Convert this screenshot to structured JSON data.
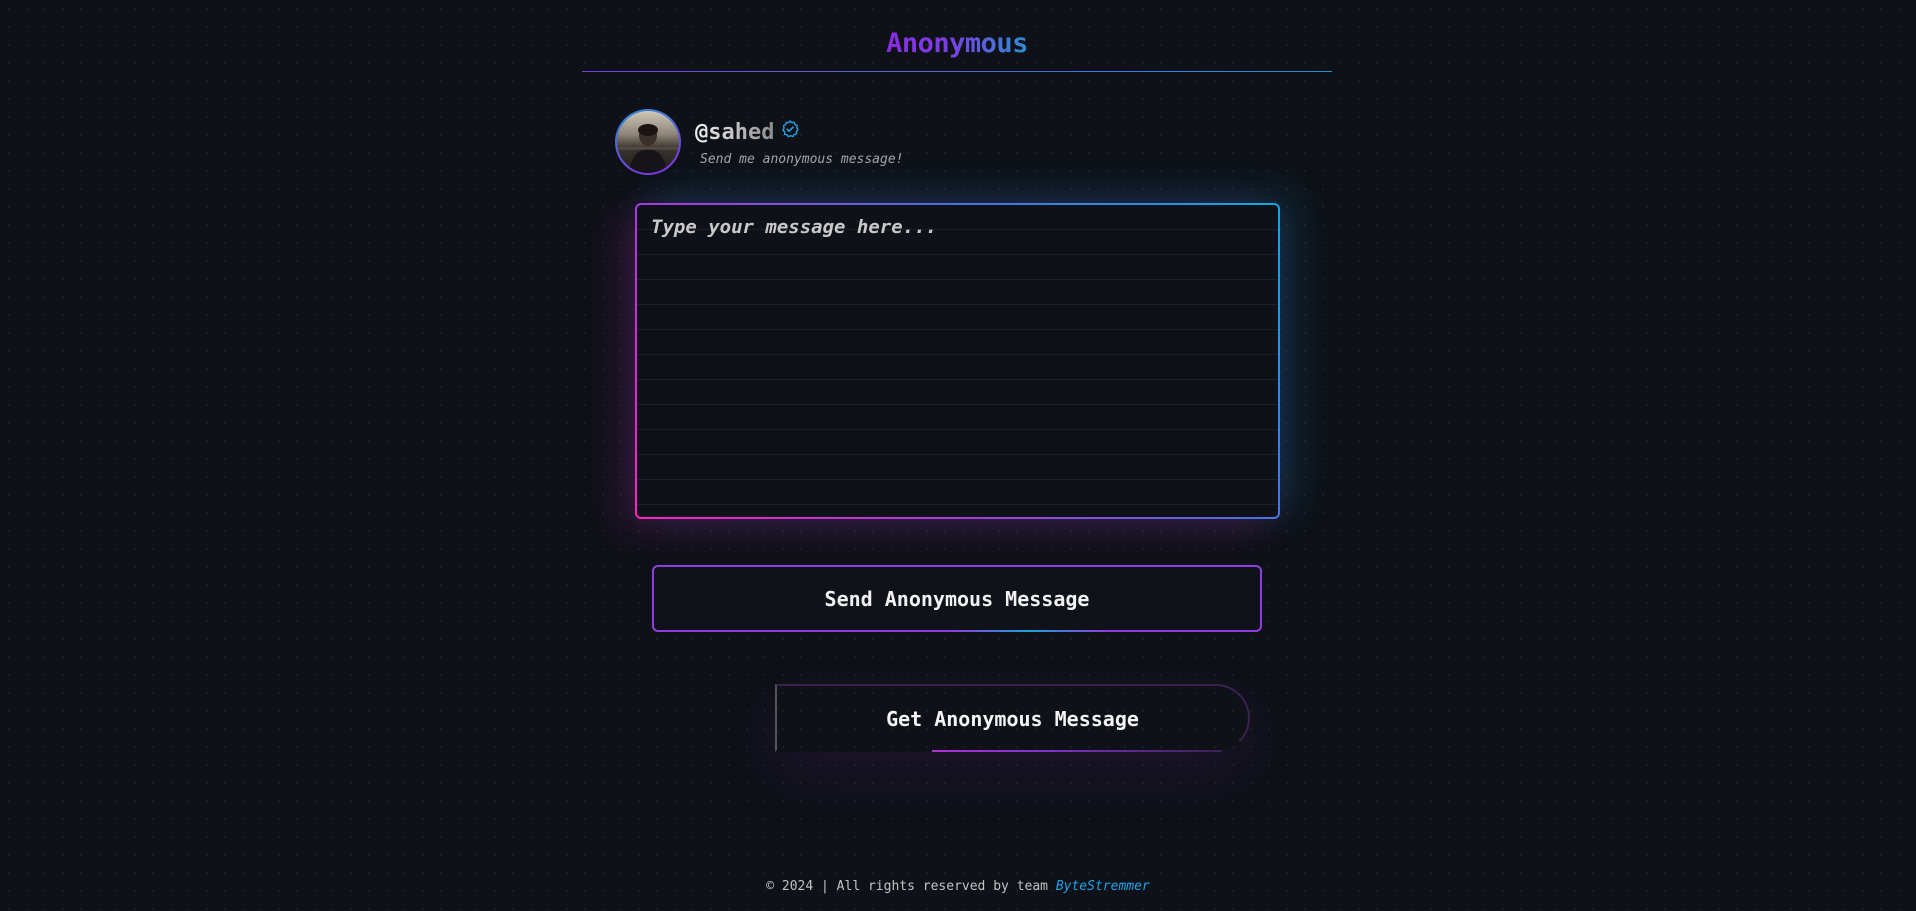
{
  "header": {
    "title": "Anonymous"
  },
  "profile": {
    "username": "@sahed",
    "verified_icon": "verified-badge-icon",
    "tagline": "Send me anonymous message!"
  },
  "message": {
    "placeholder": "Type your message here...",
    "value": ""
  },
  "actions": {
    "send_label": "Send Anonymous Message",
    "get_label": "Get Anonymous Message"
  },
  "footer": {
    "copyright_text": "© 2024 | All rights reserved by team",
    "team_name": "ByteStremmer"
  },
  "colors": {
    "background": "#0e1117",
    "accent_purple": "#8a2be2",
    "accent_blue": "#2a8fd6",
    "accent_pink": "#ff1fc8",
    "link_blue": "#1ea2e8"
  }
}
